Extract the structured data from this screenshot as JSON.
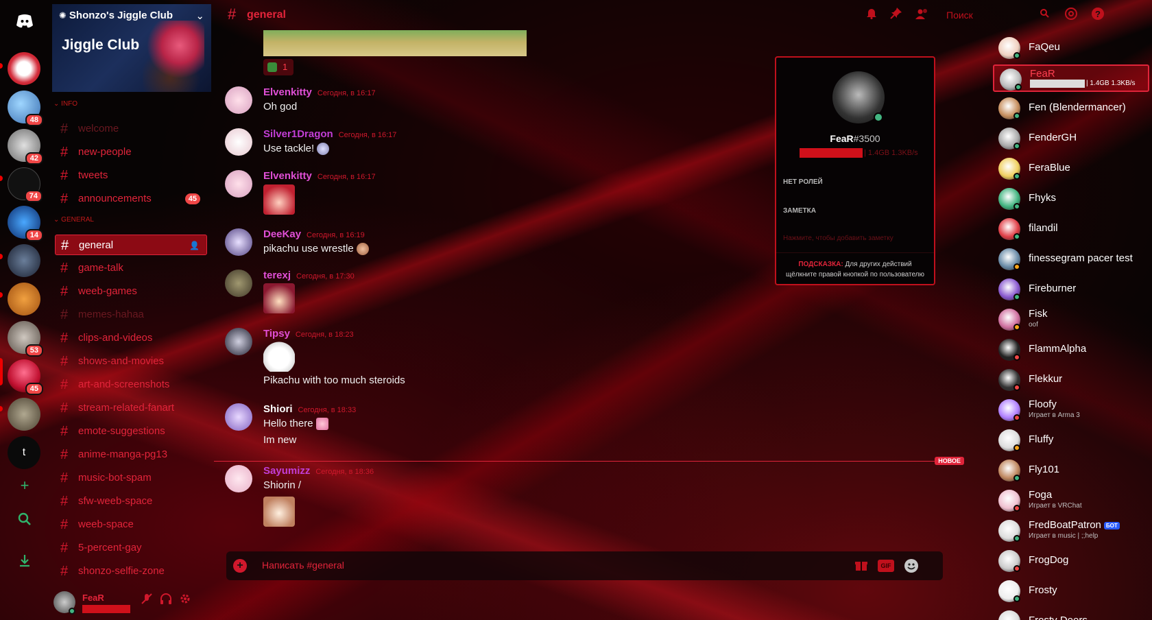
{
  "server": {
    "name": "Shonzo's Jiggle Club",
    "banner_title": "Jiggle Club"
  },
  "guild_badges": [
    "48",
    "42",
    "74",
    "14",
    "53",
    "45"
  ],
  "guild_text_icon": "t",
  "categories": {
    "info": "INFO",
    "general": "GENERAL"
  },
  "channels_info": [
    {
      "name": "welcome",
      "muted": true
    },
    {
      "name": "new-people"
    },
    {
      "name": "tweets"
    },
    {
      "name": "announcements",
      "count": "45"
    }
  ],
  "channels_general": [
    {
      "name": "general",
      "active": true
    },
    {
      "name": "game-talk"
    },
    {
      "name": "weeb-games"
    },
    {
      "name": "memes-hahaa",
      "muted": true
    },
    {
      "name": "clips-and-videos"
    },
    {
      "name": "shows-and-movies"
    },
    {
      "name": "art-and-screenshots"
    },
    {
      "name": "stream-related-fanart"
    },
    {
      "name": "emote-suggestions"
    },
    {
      "name": "anime-manga-pg13"
    },
    {
      "name": "music-bot-spam"
    },
    {
      "name": "sfw-weeb-space"
    },
    {
      "name": "weeb-space"
    },
    {
      "name": "5-percent-gay"
    },
    {
      "name": "shonzo-selfie-zone"
    }
  ],
  "user_panel": {
    "name": "FeaR"
  },
  "header": {
    "channel": "general",
    "search_placeholder": "Поиск"
  },
  "reaction_count": "1",
  "messages": [
    {
      "author": "Elvenkitty",
      "color": "#e04fd6",
      "time": "Сегодня, в 16:17",
      "lines": [
        "Oh god"
      ]
    },
    {
      "author": "Silver1Dragon",
      "color": "#c23ed6",
      "time": "Сегодня, в 16:17",
      "lines": [
        "Use tackle!"
      ]
    },
    {
      "author": "Elvenkitty",
      "color": "#e04fd6",
      "time": "Сегодня, в 16:17",
      "lines": []
    },
    {
      "author": "DeeKay",
      "color": "#e04fd6",
      "time": "Сегодня, в 16:19",
      "lines": [
        "pikachu use wrestle"
      ]
    },
    {
      "author": "terexj",
      "color": "#e04fd6",
      "time": "Сегодня, в 17:30",
      "lines": []
    },
    {
      "author": "Tipsy",
      "color": "#e04fd6",
      "time": "Сегодня, в 18:23",
      "lines": [
        "Pikachu with too much steroids"
      ]
    },
    {
      "author": "Shiori",
      "color": "#ffffff",
      "time": "Сегодня, в 18:33",
      "lines": [
        "Hello there",
        "Im new"
      ]
    },
    {
      "author": "Sayumizz",
      "color": "#c23ed6",
      "time": "Сегодня, в 18:36",
      "lines": [
        "Shiorin /"
      ]
    }
  ],
  "new_label": "НОВОЕ",
  "composer": {
    "placeholder": "Написать #general",
    "gif_label": "GIF"
  },
  "popout": {
    "name": "FeaR",
    "discriminator": "#3500",
    "stats": "| 1.4GB 1.3KB/s",
    "roles_label": "НЕТ РОЛЕЙ",
    "note_label": "ЗАМЕТКА",
    "note_placeholder": "Нажмите, чтобы добавить заметку",
    "hint_label": "ПОДСКАЗКА:",
    "hint_text": "Для других действий щёлкните правой кнопкой по пользователю"
  },
  "members": [
    {
      "name": "FaQeu",
      "status": "online"
    },
    {
      "name": "FeaR",
      "status": "online",
      "selected": true,
      "stats": "| 1.4GB 1.3KB/s"
    },
    {
      "name": "Fen (Blendermancer)",
      "status": "online"
    },
    {
      "name": "FenderGH",
      "status": "online"
    },
    {
      "name": "FeraBlue",
      "status": "online"
    },
    {
      "name": "Fhyks",
      "status": "online"
    },
    {
      "name": "filandil",
      "status": "online"
    },
    {
      "name": "finessegram pacer test",
      "status": "idle"
    },
    {
      "name": "Fireburner",
      "status": "online"
    },
    {
      "name": "Fisk",
      "status": "idle",
      "sub": "oof"
    },
    {
      "name": "FlammAlpha",
      "status": "dnd"
    },
    {
      "name": "Flekkur",
      "status": "dnd"
    },
    {
      "name": "Floofy",
      "status": "dnd",
      "sub": "Играет в Arma 3"
    },
    {
      "name": "Fluffy",
      "status": "idle"
    },
    {
      "name": "Fly101",
      "status": "online"
    },
    {
      "name": "Foga",
      "status": "dnd",
      "sub": "Играет в VRChat"
    },
    {
      "name": "FredBoatPatron",
      "status": "online",
      "sub": "Играет в music | ;;help",
      "bot": "БОТ"
    },
    {
      "name": "FrogDog",
      "status": "dnd"
    },
    {
      "name": "Frosty",
      "status": "online"
    },
    {
      "name": "Frosty Deers",
      "status": "online"
    }
  ],
  "colors": {
    "accent": "#e2243a",
    "online": "#43b581",
    "idle": "#faa61a",
    "dnd": "#f04747"
  }
}
